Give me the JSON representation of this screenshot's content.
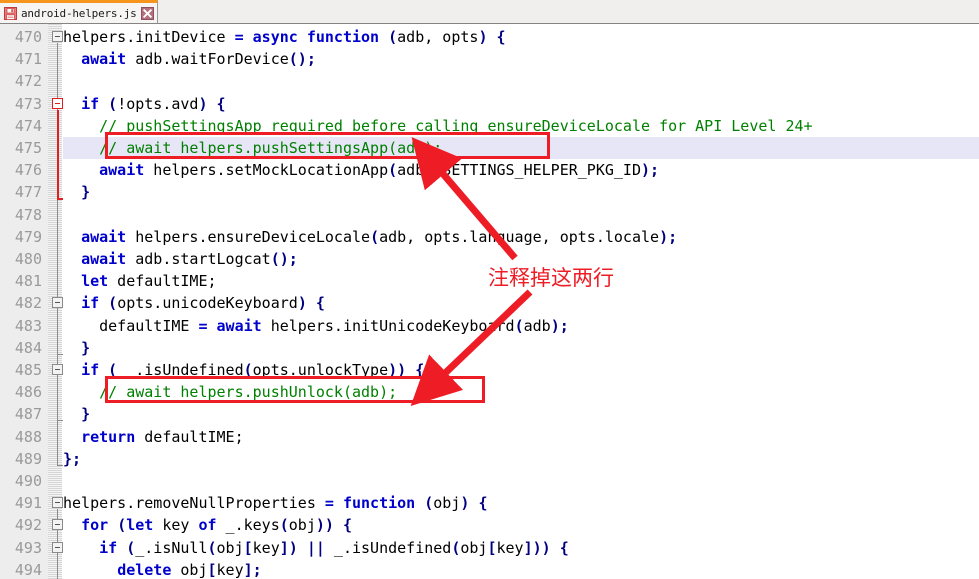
{
  "tab": {
    "title": "android-helpers.js",
    "save_icon": "floppy-disk-icon",
    "close_icon": "close-icon"
  },
  "editor": {
    "first_line_number": 470,
    "highlighted_line": 475,
    "lines": [
      {
        "num": 470,
        "tokens": [
          {
            "t": "plain",
            "v": "helpers.initDevice "
          },
          {
            "t": "kw",
            "v": "="
          },
          {
            "t": "plain",
            "v": " "
          },
          {
            "t": "kw",
            "v": "async function"
          },
          {
            "t": "plain",
            "v": " "
          },
          {
            "t": "punct",
            "v": "("
          },
          {
            "t": "plain",
            "v": "adb, opts"
          },
          {
            "t": "punct",
            "v": ")"
          },
          {
            "t": "plain",
            "v": " "
          },
          {
            "t": "punct",
            "v": "{"
          }
        ]
      },
      {
        "num": 471,
        "tokens": [
          {
            "t": "plain",
            "v": "  "
          },
          {
            "t": "kw",
            "v": "await"
          },
          {
            "t": "plain",
            "v": " adb.waitForDevice"
          },
          {
            "t": "punct",
            "v": "()"
          },
          {
            "t": "punct",
            "v": ";"
          }
        ]
      },
      {
        "num": 472,
        "tokens": []
      },
      {
        "num": 473,
        "tokens": [
          {
            "t": "plain",
            "v": "  "
          },
          {
            "t": "kw",
            "v": "if"
          },
          {
            "t": "plain",
            "v": " "
          },
          {
            "t": "punct",
            "v": "("
          },
          {
            "t": "plain",
            "v": "!opts.avd"
          },
          {
            "t": "punct",
            "v": ")"
          },
          {
            "t": "plain",
            "v": " "
          },
          {
            "t": "punct",
            "v": "{"
          }
        ]
      },
      {
        "num": 474,
        "tokens": [
          {
            "t": "plain",
            "v": "    "
          },
          {
            "t": "comment",
            "v": "// pushSettingsApp required before calling ensureDeviceLocale for API Level 24+"
          }
        ]
      },
      {
        "num": 475,
        "tokens": [
          {
            "t": "plain",
            "v": "    "
          },
          {
            "t": "comment",
            "v": "// await helpers.pushSettingsApp(adb);"
          }
        ]
      },
      {
        "num": 476,
        "tokens": [
          {
            "t": "plain",
            "v": "    "
          },
          {
            "t": "kw",
            "v": "await"
          },
          {
            "t": "plain",
            "v": " helpers.setMockLocationApp"
          },
          {
            "t": "punct",
            "v": "("
          },
          {
            "t": "plain",
            "v": "adb, SETTINGS_HELPER_PKG_ID"
          },
          {
            "t": "punct",
            "v": ")"
          },
          {
            "t": "punct",
            "v": ";"
          }
        ]
      },
      {
        "num": 477,
        "tokens": [
          {
            "t": "plain",
            "v": "  "
          },
          {
            "t": "punct",
            "v": "}"
          }
        ]
      },
      {
        "num": 478,
        "tokens": []
      },
      {
        "num": 479,
        "tokens": [
          {
            "t": "plain",
            "v": "  "
          },
          {
            "t": "kw",
            "v": "await"
          },
          {
            "t": "plain",
            "v": " helpers.ensureDeviceLocale"
          },
          {
            "t": "punct",
            "v": "("
          },
          {
            "t": "plain",
            "v": "adb, opts.language, opts.locale"
          },
          {
            "t": "punct",
            "v": ")"
          },
          {
            "t": "punct",
            "v": ";"
          }
        ]
      },
      {
        "num": 480,
        "tokens": [
          {
            "t": "plain",
            "v": "  "
          },
          {
            "t": "kw",
            "v": "await"
          },
          {
            "t": "plain",
            "v": " adb.startLogcat"
          },
          {
            "t": "punct",
            "v": "()"
          },
          {
            "t": "punct",
            "v": ";"
          }
        ]
      },
      {
        "num": 481,
        "tokens": [
          {
            "t": "plain",
            "v": "  "
          },
          {
            "t": "kw",
            "v": "let"
          },
          {
            "t": "plain",
            "v": " defaultIME;"
          }
        ]
      },
      {
        "num": 482,
        "tokens": [
          {
            "t": "plain",
            "v": "  "
          },
          {
            "t": "kw",
            "v": "if"
          },
          {
            "t": "plain",
            "v": " "
          },
          {
            "t": "punct",
            "v": "("
          },
          {
            "t": "plain",
            "v": "opts.unicodeKeyboard"
          },
          {
            "t": "punct",
            "v": ")"
          },
          {
            "t": "plain",
            "v": " "
          },
          {
            "t": "punct",
            "v": "{"
          }
        ]
      },
      {
        "num": 483,
        "tokens": [
          {
            "t": "plain",
            "v": "    defaultIME "
          },
          {
            "t": "kw",
            "v": "="
          },
          {
            "t": "plain",
            "v": " "
          },
          {
            "t": "kw",
            "v": "await"
          },
          {
            "t": "plain",
            "v": " helpers.initUnicodeKeyboard"
          },
          {
            "t": "punct",
            "v": "("
          },
          {
            "t": "plain",
            "v": "adb"
          },
          {
            "t": "punct",
            "v": ")"
          },
          {
            "t": "punct",
            "v": ";"
          }
        ]
      },
      {
        "num": 484,
        "tokens": [
          {
            "t": "plain",
            "v": "  "
          },
          {
            "t": "punct",
            "v": "}"
          }
        ]
      },
      {
        "num": 485,
        "tokens": [
          {
            "t": "plain",
            "v": "  "
          },
          {
            "t": "kw",
            "v": "if"
          },
          {
            "t": "plain",
            "v": " "
          },
          {
            "t": "punct",
            "v": "("
          },
          {
            "t": "plain",
            "v": " _.isUndefined"
          },
          {
            "t": "punct",
            "v": "("
          },
          {
            "t": "plain",
            "v": "opts.unlockType"
          },
          {
            "t": "punct",
            "v": "))"
          },
          {
            "t": "plain",
            "v": " "
          },
          {
            "t": "punct",
            "v": "{"
          }
        ]
      },
      {
        "num": 486,
        "tokens": [
          {
            "t": "plain",
            "v": "    "
          },
          {
            "t": "comment",
            "v": "// await helpers.pushUnlock(adb);"
          }
        ]
      },
      {
        "num": 487,
        "tokens": [
          {
            "t": "plain",
            "v": "  "
          },
          {
            "t": "punct",
            "v": "}"
          }
        ]
      },
      {
        "num": 488,
        "tokens": [
          {
            "t": "plain",
            "v": "  "
          },
          {
            "t": "kw",
            "v": "return"
          },
          {
            "t": "plain",
            "v": " defaultIME;"
          }
        ]
      },
      {
        "num": 489,
        "tokens": [
          {
            "t": "punct",
            "v": "}"
          },
          {
            "t": "punct",
            "v": ";"
          }
        ]
      },
      {
        "num": 490,
        "tokens": []
      },
      {
        "num": 491,
        "tokens": [
          {
            "t": "plain",
            "v": "helpers.removeNullProperties "
          },
          {
            "t": "kw",
            "v": "="
          },
          {
            "t": "plain",
            "v": " "
          },
          {
            "t": "kw",
            "v": "function"
          },
          {
            "t": "plain",
            "v": " "
          },
          {
            "t": "punct",
            "v": "("
          },
          {
            "t": "plain",
            "v": "obj"
          },
          {
            "t": "punct",
            "v": ")"
          },
          {
            "t": "plain",
            "v": " "
          },
          {
            "t": "punct",
            "v": "{"
          }
        ]
      },
      {
        "num": 492,
        "tokens": [
          {
            "t": "plain",
            "v": "  "
          },
          {
            "t": "kw",
            "v": "for"
          },
          {
            "t": "plain",
            "v": " "
          },
          {
            "t": "punct",
            "v": "("
          },
          {
            "t": "kw",
            "v": "let"
          },
          {
            "t": "plain",
            "v": " key "
          },
          {
            "t": "kw",
            "v": "of"
          },
          {
            "t": "plain",
            "v": " _.keys"
          },
          {
            "t": "punct",
            "v": "("
          },
          {
            "t": "plain",
            "v": "obj"
          },
          {
            "t": "punct",
            "v": "))"
          },
          {
            "t": "plain",
            "v": " "
          },
          {
            "t": "punct",
            "v": "{"
          }
        ]
      },
      {
        "num": 493,
        "tokens": [
          {
            "t": "plain",
            "v": "    "
          },
          {
            "t": "kw",
            "v": "if"
          },
          {
            "t": "plain",
            "v": " "
          },
          {
            "t": "punct",
            "v": "("
          },
          {
            "t": "plain",
            "v": "_.isNull"
          },
          {
            "t": "punct",
            "v": "("
          },
          {
            "t": "plain",
            "v": "obj"
          },
          {
            "t": "punct",
            "v": "["
          },
          {
            "t": "plain",
            "v": "key"
          },
          {
            "t": "punct",
            "v": "])"
          },
          {
            "t": "plain",
            "v": " "
          },
          {
            "t": "punct",
            "v": "||"
          },
          {
            "t": "plain",
            "v": " _.isUndefined"
          },
          {
            "t": "punct",
            "v": "("
          },
          {
            "t": "plain",
            "v": "obj"
          },
          {
            "t": "punct",
            "v": "["
          },
          {
            "t": "plain",
            "v": "key"
          },
          {
            "t": "punct",
            "v": "]))"
          },
          {
            "t": "plain",
            "v": " "
          },
          {
            "t": "punct",
            "v": "{"
          }
        ]
      },
      {
        "num": 494,
        "tokens": [
          {
            "t": "plain",
            "v": "      "
          },
          {
            "t": "kw",
            "v": "delete"
          },
          {
            "t": "plain",
            "v": " obj"
          },
          {
            "t": "punct",
            "v": "["
          },
          {
            "t": "plain",
            "v": "key"
          },
          {
            "t": "punct",
            "v": "]"
          },
          {
            "t": "punct",
            "v": ";"
          }
        ]
      }
    ],
    "fold_markers": [
      {
        "line": 470,
        "type": "open",
        "state": "normal"
      },
      {
        "line": 473,
        "type": "open",
        "state": "active"
      },
      {
        "line": 482,
        "type": "open",
        "state": "normal"
      },
      {
        "line": 485,
        "type": "open",
        "state": "normal"
      },
      {
        "line": 491,
        "type": "open",
        "state": "normal"
      },
      {
        "line": 492,
        "type": "open",
        "state": "normal"
      },
      {
        "line": 493,
        "type": "open",
        "state": "normal"
      }
    ]
  },
  "annotations": {
    "note_text": "注释掉这两行",
    "note_color": "#ee1c25",
    "boxes": [
      {
        "name": "highlight-box-line-475",
        "line": 475
      },
      {
        "name": "highlight-box-line-486",
        "line": 486
      }
    ],
    "arrows": [
      {
        "name": "arrow-to-line-475"
      },
      {
        "name": "arrow-to-line-486"
      }
    ]
  },
  "colors": {
    "keyword": "#0000cc",
    "comment": "#008000",
    "punctuation": "#000080",
    "annotation_red": "#ee1c25",
    "tab_accent": "#f7941d",
    "highlight_row": "#e6e6f7"
  }
}
